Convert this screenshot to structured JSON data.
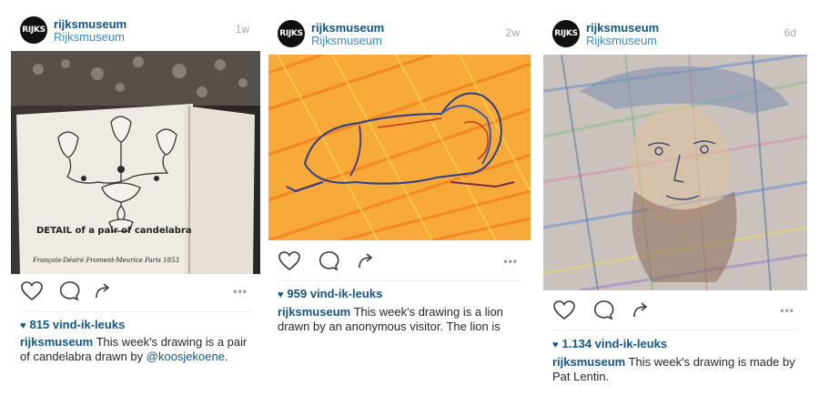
{
  "posts": [
    {
      "username": "rijksmuseum",
      "location": "Rijksmuseum",
      "time": "1w",
      "avatar_text": "RIJKS",
      "likes": "815 vind-ik-leuks",
      "caption_user": "rijksmuseum",
      "caption_text": " This week's drawing is a pair of candelabra drawn by ",
      "caption_mention": "@koosjekoene",
      "caption_tail": ".",
      "sketch_title": "DETAIL of a pair of candelabra",
      "sketch_signature": "François-Désiré Froment-Meurice Paris 1853"
    },
    {
      "username": "rijksmuseum",
      "location": "Rijksmuseum",
      "time": "2w",
      "avatar_text": "RIJKS",
      "likes": "959 vind-ik-leuks",
      "caption_user": "rijksmuseum",
      "caption_text": " This week's drawing is a lion drawn by an anonymous visitor. The lion is"
    },
    {
      "username": "rijksmuseum",
      "location": "Rijksmuseum",
      "time": "6d",
      "avatar_text": "RIJKS",
      "likes": "1.134 vind-ik-leuks",
      "caption_user": "rijksmuseum",
      "caption_text": " This week's drawing is made by Pat Lentin."
    }
  ],
  "icons": {
    "like": "heart-outline-icon",
    "comment": "comment-bubble-icon",
    "share": "share-arrow-icon",
    "more": "more-dots-icon",
    "likes_heart": "heart-filled-icon"
  },
  "more_label": "•••",
  "likes_heart_glyph": "♥",
  "colors": {
    "username": "#125688",
    "location": "#3d8ac8",
    "time": "#a5a7aa"
  }
}
